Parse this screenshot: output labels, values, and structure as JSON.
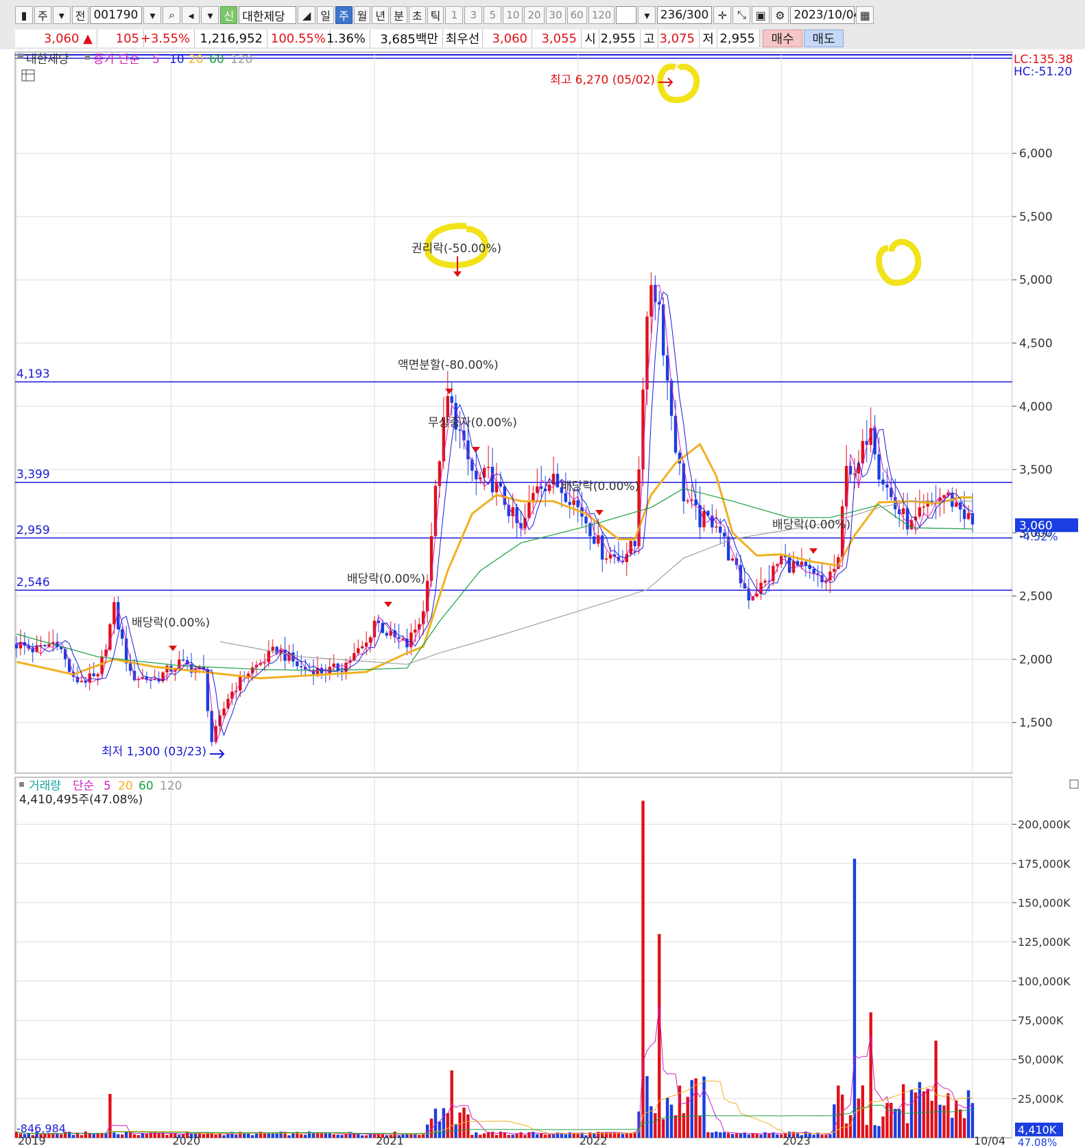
{
  "toolbar": {
    "market_label": "주",
    "prev_label": "전",
    "code": "001790",
    "badge": "신",
    "name": "대한제당",
    "period_buttons": [
      "일",
      "주",
      "월",
      "년",
      "분",
      "초",
      "틱"
    ],
    "active_period": "주",
    "interval_buttons": [
      "1",
      "3",
      "5",
      "10",
      "20",
      "30",
      "60",
      "120"
    ],
    "count": "236",
    "count_total": "/300",
    "date": "2023/10/04"
  },
  "quote": {
    "price": "3,060 ▲",
    "change": "105",
    "change_pct": "+3.55%",
    "volume": "1,216,952",
    "vol_ratio": "100.55%",
    "turnover": "1.36%",
    "amount": "3,685백만",
    "best_label": "최우선",
    "ask": "3,060",
    "bid": "3,055",
    "open_label": "시",
    "open": "2,955",
    "high_label": "고",
    "high": "3,075",
    "low_label": "저",
    "low": "2,955",
    "buy_label": "매수",
    "sell_label": "매도"
  },
  "price_panel": {
    "legend_name": "대한제당",
    "legend_ma": "종가 단순",
    "legend_periods": [
      "5",
      "10",
      "20",
      "60",
      "120"
    ],
    "lc": "LC:135.38",
    "hc": "HC:-51.20",
    "current_tag": "3,060",
    "current_pct": "-4.52%",
    "hlines": [
      {
        "value": 4193,
        "label": "4,193"
      },
      {
        "value": 3399,
        "label": "3,399"
      },
      {
        "value": 2959,
        "label": "2,959"
      },
      {
        "value": 2546,
        "label": "2,546"
      }
    ],
    "annotations": {
      "high": "최고 6,270 (05/02)",
      "low": "최저 1,300 (03/23)",
      "rights": "권리락(-50.00%)",
      "split": "액면분할(-80.00%)",
      "bonus": "무상증자(0.00%)",
      "div": "배당락(0.00%)"
    }
  },
  "volume_panel": {
    "legend_name": "거래량",
    "legend_ma": "단순",
    "legend_periods": [
      "5",
      "20",
      "60",
      "120"
    ],
    "last_value": "4,410,495주(47.08%)",
    "left_value": "-846,984",
    "tag_value": "4,410K",
    "tag_pct": "47.08%"
  },
  "chart_data": {
    "type": "candlestick",
    "title": "대한제당",
    "period": "weekly",
    "price_axis": {
      "ticks": [
        1500,
        2000,
        2500,
        3000,
        3500,
        4000,
        4500,
        5000,
        5500,
        6000
      ],
      "tick_labels": [
        "1,500",
        "2,000",
        "2,500",
        "3,000",
        "3,500",
        "4,000",
        "4,500",
        "5,000",
        "5,500",
        "6,000"
      ],
      "ylim": [
        1100,
        6800
      ]
    },
    "volume_axis": {
      "ticks": [
        25000,
        50000,
        75000,
        100000,
        125000,
        150000,
        175000,
        200000
      ],
      "tick_labels": [
        "25,000K",
        "50,000K",
        "75,000K",
        "100,000K",
        "125,000K",
        "150,000K",
        "175,000K",
        "200,000K"
      ],
      "unit": "K shares",
      "ylim": [
        0,
        230000
      ]
    },
    "x_axis": {
      "labels": [
        "2019",
        "2020",
        "2021",
        "2022",
        "2023",
        "10/04"
      ],
      "label_index": [
        0,
        38,
        88,
        138,
        188,
        235
      ],
      "count": 236
    },
    "price_series": [
      {
        "name": "close",
        "values": [
          [
            0,
            2120
          ],
          [
            5,
            2070
          ],
          [
            10,
            2150
          ],
          [
            14,
            1830
          ],
          [
            20,
            1850
          ],
          [
            24,
            2400
          ],
          [
            28,
            1870
          ],
          [
            34,
            1840
          ],
          [
            40,
            1970
          ],
          [
            46,
            1900
          ],
          [
            48,
            1350
          ],
          [
            52,
            1700
          ],
          [
            56,
            1880
          ],
          [
            60,
            1970
          ],
          [
            64,
            2080
          ],
          [
            70,
            1930
          ],
          [
            76,
            1900
          ],
          [
            80,
            1940
          ],
          [
            86,
            2120
          ],
          [
            88,
            2310
          ],
          [
            92,
            2180
          ],
          [
            96,
            2110
          ],
          [
            100,
            2370
          ],
          [
            104,
            3620
          ],
          [
            106,
            4050
          ],
          [
            108,
            3900
          ],
          [
            110,
            3650
          ],
          [
            113,
            3400
          ],
          [
            116,
            3450
          ],
          [
            120,
            3250
          ],
          [
            124,
            3000
          ],
          [
            128,
            3400
          ],
          [
            132,
            3400
          ],
          [
            136,
            3300
          ],
          [
            140,
            3100
          ],
          [
            144,
            2850
          ],
          [
            148,
            2800
          ],
          [
            152,
            2900
          ],
          [
            154,
            4200
          ],
          [
            156,
            5000
          ],
          [
            158,
            4800
          ],
          [
            160,
            4200
          ],
          [
            162,
            3700
          ],
          [
            164,
            3300
          ],
          [
            168,
            3100
          ],
          [
            172,
            3100
          ],
          [
            176,
            2750
          ],
          [
            180,
            2500
          ],
          [
            184,
            2600
          ],
          [
            188,
            2800
          ],
          [
            190,
            2750
          ],
          [
            194,
            2700
          ],
          [
            198,
            2600
          ],
          [
            202,
            2750
          ],
          [
            204,
            3600
          ],
          [
            206,
            3400
          ],
          [
            210,
            3900
          ],
          [
            212,
            3500
          ],
          [
            216,
            3200
          ],
          [
            220,
            3050
          ],
          [
            224,
            3200
          ],
          [
            228,
            3300
          ],
          [
            232,
            3200
          ],
          [
            235,
            3060
          ]
        ]
      },
      {
        "name": "ma20",
        "values": [
          [
            0,
            1980
          ],
          [
            14,
            1880
          ],
          [
            24,
            2000
          ],
          [
            34,
            1940
          ],
          [
            46,
            1900
          ],
          [
            60,
            1850
          ],
          [
            76,
            1880
          ],
          [
            86,
            1900
          ],
          [
            96,
            2050
          ],
          [
            100,
            2100
          ],
          [
            106,
            2700
          ],
          [
            112,
            3150
          ],
          [
            118,
            3300
          ],
          [
            124,
            3250
          ],
          [
            132,
            3250
          ],
          [
            140,
            3150
          ],
          [
            148,
            2950
          ],
          [
            152,
            2950
          ],
          [
            156,
            3300
          ],
          [
            162,
            3550
          ],
          [
            168,
            3700
          ],
          [
            172,
            3450
          ],
          [
            176,
            3000
          ],
          [
            182,
            2820
          ],
          [
            188,
            2830
          ],
          [
            196,
            2770
          ],
          [
            202,
            2740
          ],
          [
            206,
            2980
          ],
          [
            212,
            3240
          ],
          [
            220,
            3250
          ],
          [
            226,
            3230
          ],
          [
            232,
            3280
          ],
          [
            235,
            3280
          ]
        ]
      },
      {
        "name": "ma60",
        "values": [
          [
            0,
            2200
          ],
          [
            20,
            2020
          ],
          [
            40,
            1950
          ],
          [
            60,
            1920
          ],
          [
            76,
            1910
          ],
          [
            96,
            1930
          ],
          [
            104,
            2300
          ],
          [
            114,
            2700
          ],
          [
            124,
            2920
          ],
          [
            140,
            3050
          ],
          [
            156,
            3200
          ],
          [
            164,
            3350
          ],
          [
            176,
            3250
          ],
          [
            190,
            3120
          ],
          [
            200,
            3120
          ],
          [
            212,
            3220
          ],
          [
            220,
            3040
          ],
          [
            235,
            3030
          ]
        ]
      },
      {
        "name": "ma120",
        "values": [
          [
            50,
            2140
          ],
          [
            70,
            2020
          ],
          [
            96,
            1960
          ],
          [
            104,
            2050
          ],
          [
            120,
            2200
          ],
          [
            140,
            2400
          ],
          [
            155,
            2550
          ],
          [
            164,
            2800
          ],
          [
            176,
            2950
          ],
          [
            200,
            3080
          ],
          [
            212,
            3200
          ],
          [
            220,
            3250
          ],
          [
            235,
            3250
          ]
        ]
      }
    ],
    "volume_peaks": [
      {
        "x": 23,
        "value": 28000
      },
      {
        "x": 107,
        "value": 43000
      },
      {
        "x": 154,
        "value": 215000
      },
      {
        "x": 158,
        "value": 130000
      },
      {
        "x": 206,
        "value": 178000
      },
      {
        "x": 210,
        "value": 80000
      },
      {
        "x": 226,
        "value": 62000
      }
    ]
  }
}
